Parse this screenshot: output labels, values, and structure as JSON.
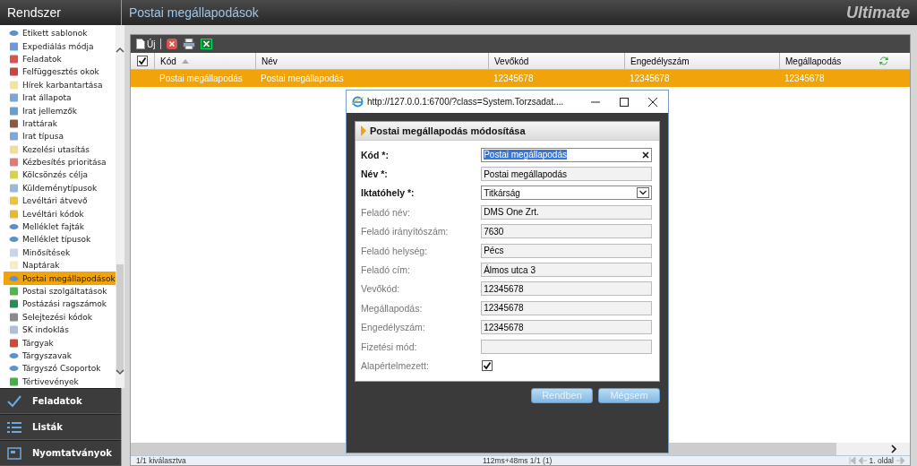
{
  "sidebar": {
    "title": "Rendszer",
    "items": [
      {
        "label": "Etikett sablonok",
        "selected": false,
        "kind": "ellipse",
        "color": "#5b8fc9"
      },
      {
        "label": "Expediálás módja",
        "selected": false,
        "kind": "square",
        "color": "#6a9bd8"
      },
      {
        "label": "Feladatok",
        "selected": false,
        "kind": "square",
        "color": "#d9534f"
      },
      {
        "label": "Felfüggesztés okok",
        "selected": false,
        "kind": "square",
        "color": "#c9453f"
      },
      {
        "label": "Hírek karbantartása",
        "selected": false,
        "kind": "square",
        "color": "#f2e3a0"
      },
      {
        "label": "Irat állapota",
        "selected": false,
        "kind": "square",
        "color": "#7aa6d8"
      },
      {
        "label": "Irat jellemzők",
        "selected": false,
        "kind": "square",
        "color": "#6f9ccf"
      },
      {
        "label": "Irattárak",
        "selected": false,
        "kind": "square",
        "color": "#8b5a3c"
      },
      {
        "label": "Irat típusa",
        "selected": false,
        "kind": "square",
        "color": "#80a8d6"
      },
      {
        "label": "Kezelési utasítás",
        "selected": false,
        "kind": "square",
        "color": "#f2dd9a"
      },
      {
        "label": "Kézbesítés prioritása",
        "selected": false,
        "kind": "square",
        "color": "#e07a7a"
      },
      {
        "label": "Kölcsönzés célja",
        "selected": false,
        "kind": "square",
        "color": "#d8d050"
      },
      {
        "label": "Küldeménytípusok",
        "selected": false,
        "kind": "square",
        "color": "#9bb8d8"
      },
      {
        "label": "Levéltári átvevő",
        "selected": false,
        "kind": "square",
        "color": "#f0c040"
      },
      {
        "label": "Levéltári kódok",
        "selected": false,
        "kind": "square",
        "color": "#e8b830"
      },
      {
        "label": "Melléklet fajták",
        "selected": false,
        "kind": "ellipse",
        "color": "#5a8ec8"
      },
      {
        "label": "Melléklet típusok",
        "selected": false,
        "kind": "ellipse",
        "color": "#5c90ca"
      },
      {
        "label": "Minősítések",
        "selected": false,
        "kind": "square",
        "color": "#c8d4e8"
      },
      {
        "label": "Naptárak",
        "selected": false,
        "kind": "square",
        "color": "#f5ecc8"
      },
      {
        "label": "Postai megállapodások",
        "selected": true,
        "kind": "ellipse",
        "color": "#5e92cc"
      },
      {
        "label": "Postai szolgáltatások",
        "selected": false,
        "kind": "square",
        "color": "#4cb84c"
      },
      {
        "label": "Postázási ragszámok",
        "selected": false,
        "kind": "square",
        "color": "#2a8a5a"
      },
      {
        "label": "Selejtezési kódok",
        "selected": false,
        "kind": "square",
        "color": "#8a8a8a"
      },
      {
        "label": "SK indoklás",
        "selected": false,
        "kind": "square",
        "color": "#b0c0d8"
      },
      {
        "label": "Tárgyak",
        "selected": false,
        "kind": "square",
        "color": "#d04a3a"
      },
      {
        "label": "Tárgyszavak",
        "selected": false,
        "kind": "ellipse",
        "color": "#5d91cb"
      },
      {
        "label": "Tárgyszó Csoportok",
        "selected": false,
        "kind": "ellipse",
        "color": "#5f93cd"
      },
      {
        "label": "Tértivevények",
        "selected": false,
        "kind": "square",
        "color": "#45b045"
      }
    ],
    "nav": [
      {
        "label": "Feladatok",
        "kind": "check"
      },
      {
        "label": "Listák",
        "kind": "list"
      },
      {
        "label": "Nyomtatványok",
        "kind": "form"
      }
    ]
  },
  "header": {
    "title": "Postai megállapodások",
    "logo": "Ultimate"
  },
  "toolbar": {
    "new_label": "Új"
  },
  "table": {
    "all_checked": true,
    "columns": [
      {
        "label": "Kód",
        "sorted": true
      },
      {
        "label": "Név",
        "sorted": false
      },
      {
        "label": "Vevőkód",
        "sorted": false
      },
      {
        "label": "Engedélyszám",
        "sorted": false
      },
      {
        "label": "Megállapodás",
        "sorted": false
      }
    ],
    "rows": [
      {
        "selected": true,
        "cells": [
          "Postai megállapodás",
          "Postai megállapodás",
          "12345678",
          "12345678",
          "12345678"
        ]
      }
    ]
  },
  "status": {
    "selection": "1/1 kiválasztva",
    "timing": "112ms+48ms 1/1 (1)",
    "page": "1. oldal"
  },
  "dialog": {
    "title": "http://127.0.0.1:6700/?class=System.Torzsadat....",
    "heading": "Postai megállapodás módosítása",
    "fields": [
      {
        "label": "Kód *:",
        "required": true,
        "kind": "text",
        "value": "Postai megállapodás",
        "highlighted": true
      },
      {
        "label": "Név *:",
        "required": true,
        "kind": "text",
        "value": "Postai megállapodás",
        "highlighted": false
      },
      {
        "label": "Iktatóhely *:",
        "required": true,
        "kind": "select",
        "value": "Titkárság"
      },
      {
        "label": "Feladó név:",
        "required": false,
        "kind": "text",
        "value": "DMS One Zrt.",
        "highlighted": false
      },
      {
        "label": "Feladó irányítószám:",
        "required": false,
        "kind": "text",
        "value": "7630",
        "highlighted": false
      },
      {
        "label": "Feladó helység:",
        "required": false,
        "kind": "text",
        "value": "Pécs",
        "highlighted": false
      },
      {
        "label": "Feladó cím:",
        "required": false,
        "kind": "text",
        "value": "Álmos utca 3",
        "highlighted": false
      },
      {
        "label": "Vevőkód:",
        "required": false,
        "kind": "text",
        "value": "12345678",
        "highlighted": false
      },
      {
        "label": "Megállapodás:",
        "required": false,
        "kind": "text",
        "value": "12345678",
        "highlighted": false
      },
      {
        "label": "Engedélyszám:",
        "required": false,
        "kind": "text",
        "value": "12345678",
        "highlighted": false
      },
      {
        "label": "Fizetési mód:",
        "required": false,
        "kind": "text",
        "highlighted": false
      },
      {
        "label": "Alapértelmezett:",
        "required": false,
        "kind": "checkbox",
        "checked": true
      }
    ],
    "buttons": [
      "Rendben",
      "Mégsem"
    ]
  }
}
